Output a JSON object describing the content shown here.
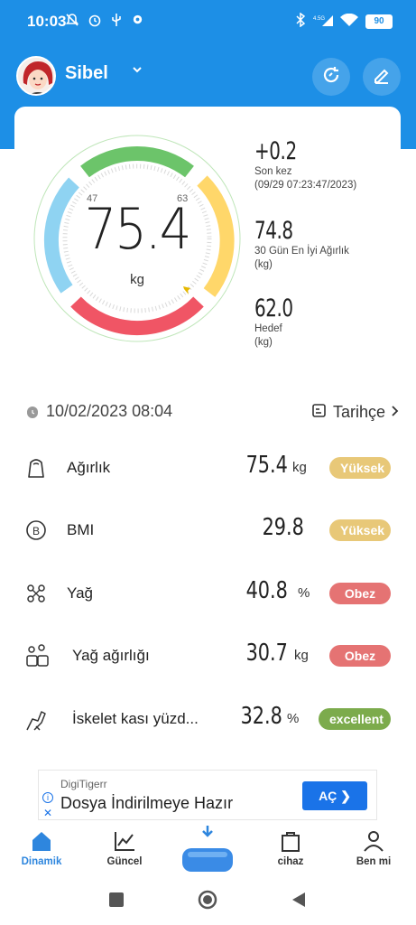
{
  "status_bar": {
    "time": "10:03",
    "network": "4.5G",
    "battery": "90"
  },
  "user": {
    "name": "Sibel"
  },
  "gauge": {
    "weight": "75.4",
    "unit": "kg",
    "tick_low": "47",
    "tick_high": "63",
    "colors": {
      "blue": "#8fd3f2",
      "green": "#6cc46a",
      "yellow": "#ffd76a",
      "red": "#f05565"
    }
  },
  "stats": [
    {
      "value": "+0.2",
      "label1": "Son kez",
      "label2": "(09/29 07:23:47/2023)"
    },
    {
      "value": "74.8",
      "label1": "30 Gün En İyi Ağırlık",
      "label2": "(kg)"
    },
    {
      "value": "62.0",
      "label1": "Hedef",
      "label2": "(kg)"
    }
  ],
  "date_row": {
    "date": "10/02/2023 08:04",
    "history_label": "Tarihçe"
  },
  "metrics": [
    {
      "label": "Ağırlık",
      "value": "75.4",
      "unit": "kg",
      "badge": "Yüksek",
      "badge_color": "#e8c878"
    },
    {
      "label": "BMI",
      "value": "29.8",
      "unit": "",
      "badge": "Yüksek",
      "badge_color": "#e8c878"
    },
    {
      "label": "Yağ",
      "value": "40.8",
      "unit": "%",
      "badge": "Obez",
      "badge_color": "#e57373"
    },
    {
      "label": "Yağ ağırlığı",
      "value": "30.7",
      "unit": "kg",
      "badge": "Obez",
      "badge_color": "#e57373"
    },
    {
      "label": "İskelet kası yüzd...",
      "value": "32.8",
      "unit": "%",
      "badge": "excellent",
      "badge_color": "#7cab4c"
    }
  ],
  "ad": {
    "brand": "DigiTigerr",
    "title": "Dosya İndirilmeye Hazır",
    "button": "AÇ"
  },
  "nav": {
    "items": [
      {
        "label": "Dinamik",
        "icon": "home-icon"
      },
      {
        "label": "Güncel",
        "icon": "chart-icon"
      },
      {
        "label": "",
        "icon": "scale-icon"
      },
      {
        "label": "cihaz",
        "icon": "bag-icon"
      },
      {
        "label": "Ben mi",
        "icon": "person-icon"
      }
    ]
  }
}
